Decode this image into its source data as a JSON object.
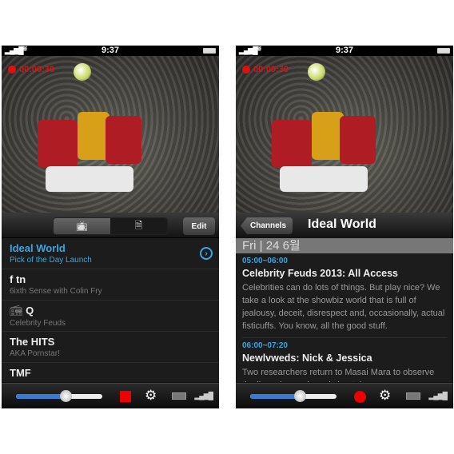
{
  "status": {
    "time": "9:37",
    "signal": "▂▄▆█",
    "wifi": "wifi"
  },
  "recording": {
    "elapsed": "00:00:30"
  },
  "colors": {
    "accent": "#3aa6e0",
    "record": "#e01010"
  },
  "left": {
    "toolbar": {
      "tab_tv_icon": "tv-icon",
      "tab_guide_icon": "document-icon",
      "edit_label": "Edit"
    },
    "channels": [
      {
        "name": "Ideal World",
        "program": "Pick of the Day Launch",
        "selected": true
      },
      {
        "name": "f tn",
        "program": "6ixth Sense with Colin Fry"
      },
      {
        "name": "Q",
        "program": "Celebrity Feuds",
        "icon": "radio-icon"
      },
      {
        "name": "The HITS",
        "program": "AKA Pornstar!"
      },
      {
        "name": "TMF",
        "program": ""
      }
    ]
  },
  "right": {
    "nav": {
      "back_label": "Channels",
      "title": "Ideal World"
    },
    "date": "Fri | 24 6월",
    "programs": [
      {
        "time": "05:00~06:00",
        "title": "Celebrity Feuds 2013: All Access",
        "desc": "Celebrities can do lots of things. But play nice? We take a look at the showbiz world that is full of jealousy, deceit, disrespect and, occasionally, actual fisticuffs. You know, all the good stuff."
      },
      {
        "time": "06:00~07:20",
        "title": "Newlvweds: Nick & Jessica",
        "desc": "Two researchers return to Masai Mara to observe the lions, leopards and cheetahs"
      }
    ]
  },
  "bottom": {
    "volume": 0.58,
    "gear": "⚙",
    "bars": "▂▄▆█"
  }
}
